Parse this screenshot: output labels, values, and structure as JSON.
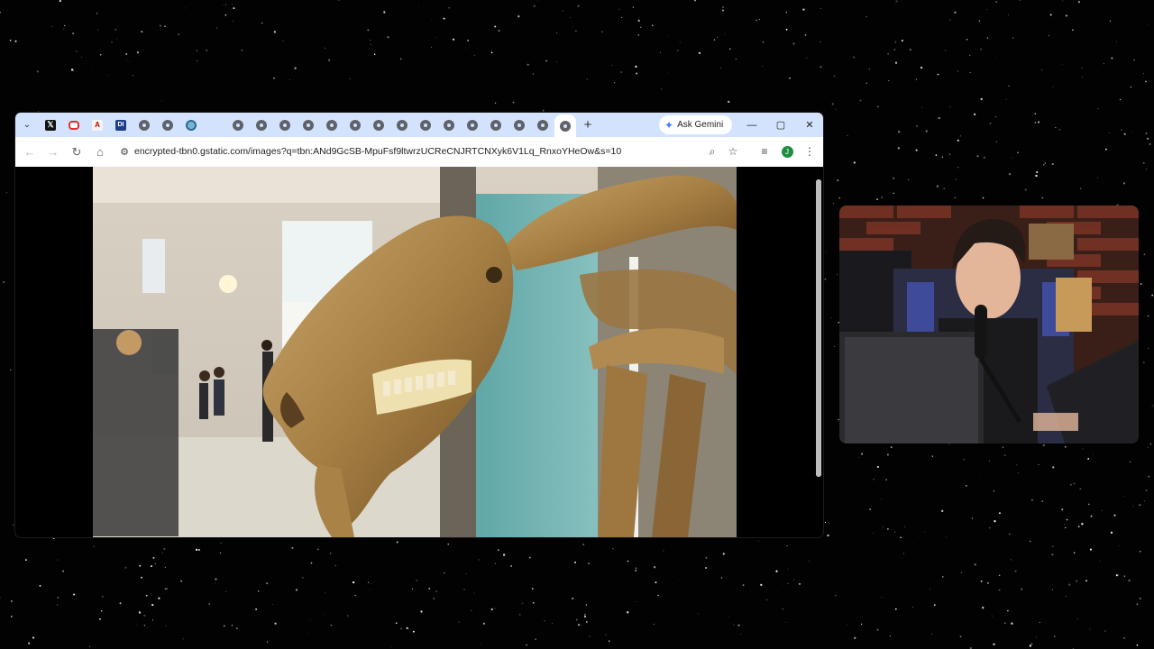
{
  "browser": {
    "tabs": [
      {
        "icon": "x-logo-icon",
        "glyph": "𝕏",
        "kind": "x"
      },
      {
        "icon": "opera-icon",
        "glyph": "",
        "kind": "o"
      },
      {
        "icon": "wps-icon",
        "glyph": "A",
        "kind": "w"
      },
      {
        "icon": "di-icon",
        "glyph": "DI",
        "kind": "d"
      },
      {
        "icon": "globe-icon",
        "glyph": "",
        "kind": "g"
      },
      {
        "icon": "globe-icon",
        "glyph": "",
        "kind": "g"
      },
      {
        "icon": "wiki-icon",
        "glyph": "",
        "kind": "wk"
      },
      {
        "icon": "globe-icon",
        "glyph": "",
        "kind": "g"
      },
      {
        "icon": "globe-icon",
        "glyph": "",
        "kind": "g"
      },
      {
        "icon": "globe-icon",
        "glyph": "",
        "kind": "g"
      },
      {
        "icon": "globe-icon",
        "glyph": "",
        "kind": "g"
      },
      {
        "icon": "globe-icon",
        "glyph": "",
        "kind": "g"
      },
      {
        "icon": "globe-icon",
        "glyph": "",
        "kind": "g"
      },
      {
        "icon": "globe-icon",
        "glyph": "",
        "kind": "g"
      },
      {
        "icon": "globe-icon",
        "glyph": "",
        "kind": "g"
      },
      {
        "icon": "globe-icon",
        "glyph": "",
        "kind": "g"
      },
      {
        "icon": "globe-icon",
        "glyph": "",
        "kind": "g"
      },
      {
        "icon": "globe-icon",
        "glyph": "",
        "kind": "g"
      },
      {
        "icon": "globe-icon",
        "glyph": "",
        "kind": "g"
      },
      {
        "icon": "globe-icon",
        "glyph": "",
        "kind": "g"
      },
      {
        "icon": "globe-icon",
        "glyph": "",
        "kind": "g"
      },
      {
        "icon": "globe-icon",
        "glyph": "",
        "kind": "g",
        "active": true
      }
    ],
    "new_tab_glyph": "+",
    "gemini_label": "Ask Gemini",
    "window_controls": {
      "minimize": "—",
      "maximize": "▢",
      "close": "✕"
    },
    "url": "encrypted-tbn0.gstatic.com/images?q=tbn:ANd9GcSB-MpuFsf9ltwrzUCReCNJRTCNXyk6V1Lq_RnxoYHeOw&s=10",
    "profile_initial": "J",
    "colors": {
      "tabstrip": "#d3e3fd",
      "toolbar": "#ffffff",
      "profile": "#1e8e3e"
    }
  }
}
